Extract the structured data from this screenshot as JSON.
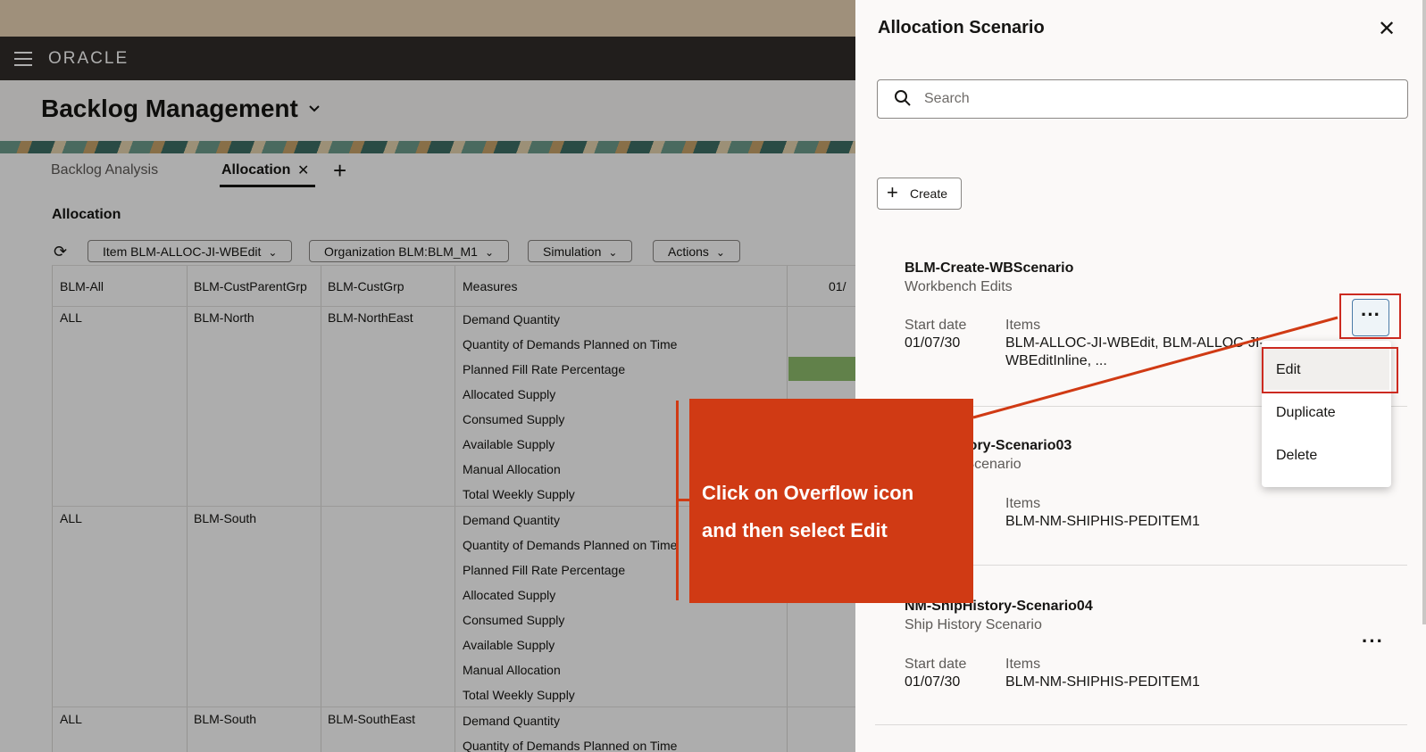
{
  "app": {
    "logo": "ORACLE",
    "page_title": "Backlog Management"
  },
  "tabs": [
    {
      "label": "Backlog Analysis"
    },
    {
      "label": "Allocation",
      "active": true
    }
  ],
  "section_title": "Allocation",
  "filters": [
    {
      "label": "Item BLM-ALLOC-JI-WBEdit"
    },
    {
      "label": "Organization BLM:BLM_M1"
    },
    {
      "label": "Simulation"
    },
    {
      "label": "Actions"
    }
  ],
  "grid": {
    "columns": [
      "BLM-All",
      "BLM-CustParentGrp",
      "BLM-CustGrp",
      "Measures",
      "01/"
    ],
    "groups": [
      {
        "c1": "ALL",
        "c2": "BLM-North",
        "c3": "BLM-NorthEast",
        "measures": [
          "Demand Quantity",
          "Quantity of Demands Planned on Time",
          "Planned Fill Rate Percentage",
          "Allocated Supply",
          "Consumed Supply",
          "Available Supply",
          "Manual Allocation",
          "Total Weekly Supply"
        ]
      },
      {
        "c1": "ALL",
        "c2": "BLM-South",
        "c3": "",
        "measures": [
          "Demand Quantity",
          "Quantity of Demands Planned on Time",
          "Planned Fill Rate Percentage",
          "Allocated Supply",
          "Consumed Supply",
          "Available Supply",
          "Manual Allocation",
          "Total Weekly Supply"
        ]
      },
      {
        "c1": "ALL",
        "c2": "BLM-South",
        "c3": "BLM-SouthEast",
        "measures": [
          "Demand Quantity",
          "Quantity of Demands Planned on Time"
        ]
      }
    ]
  },
  "drawer": {
    "title": "Allocation Scenario",
    "search_placeholder": "Search",
    "create_label": "Create",
    "start_date_label": "Start date",
    "items_label": "Items",
    "scenarios": [
      {
        "name": "BLM-Create-WBScenario",
        "type": "Workbench Edits",
        "start_date": "01/07/30",
        "items_line1": "BLM-ALLOC-JI-WBEdit, BLM-ALLOC-JI-",
        "items_line2": "WBEditInline, ..."
      },
      {
        "name": "istory-Scenario03",
        "type": "y Scenario",
        "start_date": "",
        "items_line1": "BLM-NM-SHIPHIS-PEDITEM1",
        "items_line2": ""
      },
      {
        "name": "NM-ShipHistory-Scenario04",
        "type": "Ship History Scenario",
        "start_date": "01/07/30",
        "items_line1": "BLM-NM-SHIPHIS-PEDITEM1",
        "items_line2": ""
      }
    ],
    "menu": [
      "Edit",
      "Duplicate",
      "Delete"
    ]
  },
  "callout": {
    "line1": "Click on Overflow icon",
    "line2": "and then select Edit"
  },
  "colors": {
    "callout": "#d03a14",
    "highlight": "#cc2a20",
    "brandbar": "#312d2a"
  }
}
